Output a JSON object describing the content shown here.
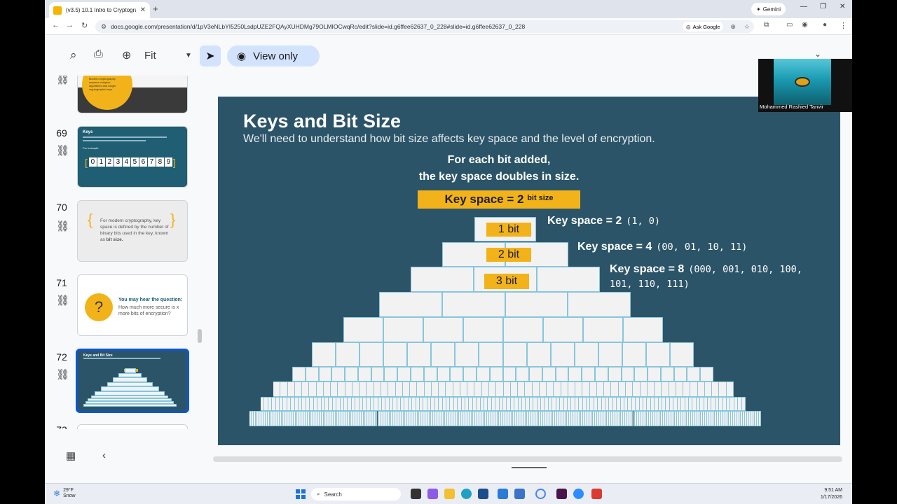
{
  "browser": {
    "tab_title": "(v3.5) 10.1 Intro to Cryptograph",
    "gemini_label": "Gemini",
    "url": "docs.google.com/presentation/d/1pV3eNLbYI5250LsdpUZE2FQAyXUHDMg79OLMIOCwqRc/edit?slide=id.g6ffee62637_0_228#slide=id.g6ffee62637_0_228",
    "ask_google_label": "Ask Google"
  },
  "toolbar": {
    "zoom_value": "Fit",
    "view_mode_label": "View only"
  },
  "filmstrip": {
    "slides": [
      {
        "number": "",
        "texts": [
          "Modern cryptography",
          "requires complex",
          "algorithms and longer",
          "cryptographic keys"
        ]
      },
      {
        "number": "69",
        "title": "Keys",
        "texts": [
          "For example:"
        ],
        "digits": [
          "0",
          "1",
          "2",
          "3",
          "4",
          "5",
          "6",
          "7",
          "8",
          "9"
        ]
      },
      {
        "number": "70",
        "text_a": "For modern cryptography, key space is defined by the number of binary bits used in the key, known as ",
        "text_b": "bit size."
      },
      {
        "number": "71",
        "q_title": "You may hear the question:",
        "q_text": "How much more secure is x more bits of encryption?"
      },
      {
        "number": "72",
        "title": "Keys and Bit Size"
      },
      {
        "number": "73"
      }
    ]
  },
  "slide": {
    "title": "Keys and Bit Size",
    "subtitle": "We'll need to understand how bit size affects key space and the level of encryption.",
    "line1": "For each bit added,",
    "line2": "the key space doubles in size.",
    "formula": "Key space = 2",
    "formula_sup": "bit size",
    "bits": [
      {
        "label": "1 bit",
        "ks": "Key space = 2",
        "values": "(1, 0)"
      },
      {
        "label": "2 bit",
        "ks": "Key space = 4",
        "values": "(00, 01, 10, 11)"
      },
      {
        "label": "3 bit",
        "ks": "Key space = 8",
        "values": "(000, 001, 010, 100,",
        "values2": "101, 110, 111)"
      }
    ]
  },
  "video": {
    "participant_name": "Mohammed Rashied Tanvir"
  },
  "taskbar": {
    "temp": "29°F",
    "weather": "Snow",
    "search_label": "Search",
    "time": "9:51 AM",
    "date": "1/17/2026"
  }
}
